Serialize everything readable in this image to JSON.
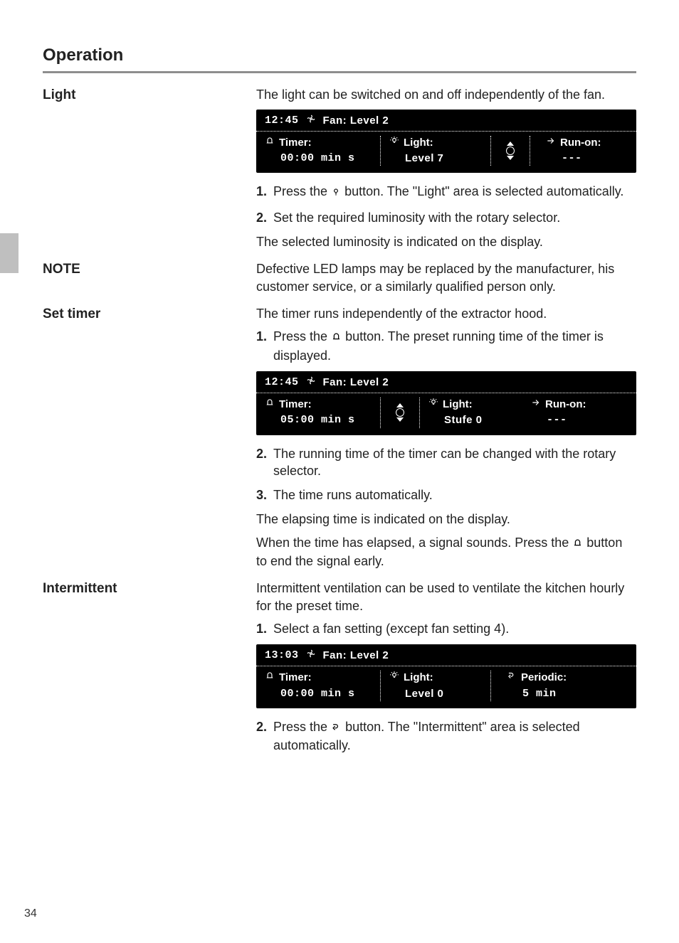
{
  "page_number": "34",
  "section_title": "Operation",
  "light": {
    "label": "Light",
    "intro": "The light can be switched on and off independently of the fan.",
    "step1_a": "Press the ",
    "step1_b": " button. The \"Light\" area is selected automatically.",
    "step2": "Set the required luminosity with the rotary selector.",
    "after": "The selected luminosity is indicated on the display."
  },
  "note": {
    "label": "NOTE",
    "text": "Defective LED lamps may be replaced by the manufacturer, his customer service, or a similarly qualified person only."
  },
  "timer": {
    "label": "Set timer",
    "intro": "The timer runs independently of the extractor hood.",
    "step1_a": "Press the ",
    "step1_b": " button. The preset running time of the timer is displayed.",
    "step2": "The running time of the timer can be changed with the rotary selector.",
    "step3": "The time runs automatically.",
    "after1": "The elapsing time is indicated on the display.",
    "after2_a": "When the time has elapsed, a signal sounds. Press the ",
    "after2_b": " button to end the signal early."
  },
  "intermittent": {
    "label": "Intermittent",
    "intro": "Intermittent ventilation can be used to ventilate the kitchen hourly for the preset time.",
    "step1": "Select a fan setting (except fan setting 4).",
    "step2_a": "Press the ",
    "step2_b": " button. The \"Intermittent\" area is selected automatically."
  },
  "display1": {
    "clock": "12:45",
    "fan": "Fan: Level 2",
    "timer_label": "Timer:",
    "timer_value": "00:00 min s",
    "light_label": "Light:",
    "light_value": "Level 7",
    "run_label": "Run-on:",
    "run_value": "---"
  },
  "display2": {
    "clock": "12:45",
    "fan": "Fan: Level 2",
    "timer_label": "Timer:",
    "timer_value": "05:00 min s",
    "light_label": "Light:",
    "light_value": "Stufe 0",
    "run_label": "Run-on:",
    "run_value": "---"
  },
  "display3": {
    "clock": "13:03",
    "fan": "Fan: Level 2",
    "timer_label": "Timer:",
    "timer_value": "00:00 min s",
    "light_label": "Light:",
    "light_value": "Level 0",
    "periodic_label": "Periodic:",
    "periodic_value": "5   min"
  }
}
